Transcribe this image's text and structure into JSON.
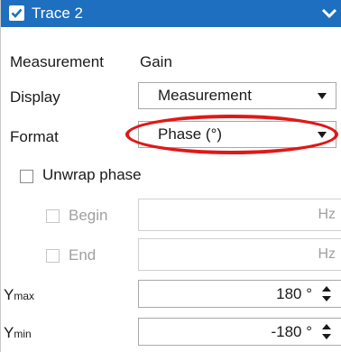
{
  "header": {
    "title": "Trace 2",
    "checked": true
  },
  "measurement": {
    "label": "Measurement",
    "value": "Gain"
  },
  "display": {
    "label": "Display",
    "selected": "Measurement"
  },
  "format": {
    "label": "Format",
    "selected": "Phase (°)"
  },
  "unwrap": {
    "label": "Unwrap phase",
    "begin": {
      "label": "Begin",
      "unit": "Hz"
    },
    "end": {
      "label": "End",
      "unit": "Hz"
    }
  },
  "ymax": {
    "label_main": "Y",
    "label_sub": "max",
    "value": "180 °"
  },
  "ymin": {
    "label_main": "Y",
    "label_sub": "min",
    "value": "-180 °"
  },
  "colors": {
    "header_bg": "#1e6fbf",
    "highlight": "#e01818"
  }
}
